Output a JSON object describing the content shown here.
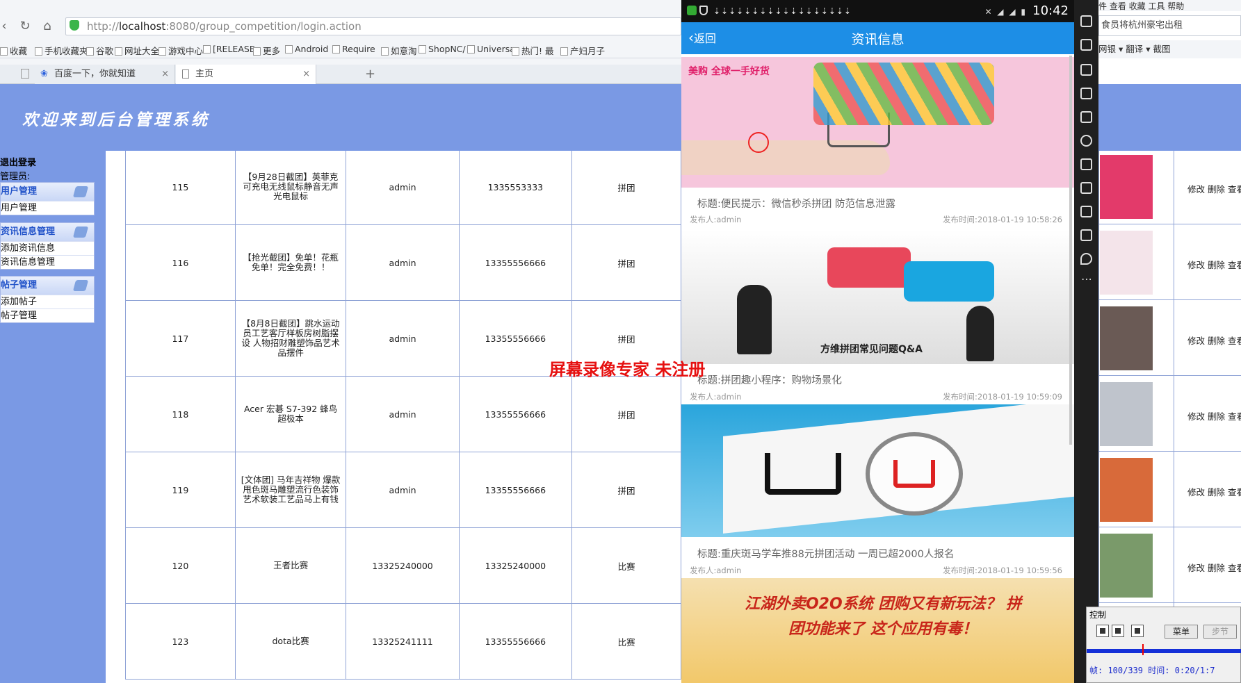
{
  "browser": {
    "url_host": "localhost",
    "url_prefix": "http://",
    "url_rest": ":8080/group_competition/login.action",
    "bookmarks": [
      "收藏",
      "手机收藏夹",
      "谷歌",
      "网址大全",
      "游戏中心",
      "[RELEASE",
      "更多",
      "Android",
      "Require",
      "如意淘",
      "ShopNC/",
      "Universa",
      "热门! 最",
      "产妇月子"
    ],
    "tabs": [
      {
        "label": "百度一下，你就知道",
        "active": false
      },
      {
        "label": "主页",
        "active": true
      }
    ]
  },
  "page": {
    "banner_title": "欢迎来到后台管理系统",
    "logout": "退出登录",
    "admin_label": "管理员:",
    "menus": [
      {
        "head": "用户管理",
        "items": [
          "用户管理"
        ]
      },
      {
        "head": "资讯信息管理",
        "items": [
          "添加资讯信息",
          "资讯信息管理"
        ]
      },
      {
        "head": "帖子管理",
        "items": [
          "添加帖子",
          "帖子管理"
        ]
      }
    ],
    "rows": [
      {
        "id": "115",
        "title": "【9月28日截团】英菲克可充电无线鼠标静音无声光电鼠标",
        "publisher": "admin",
        "phone": "1335553333",
        "type": "拼团"
      },
      {
        "id": "116",
        "title": "【抢光截团】免单！花瓶免单！完全免费！！",
        "publisher": "admin",
        "phone": "13355556666",
        "type": "拼团"
      },
      {
        "id": "117",
        "title": "【8月8日截团】跳水运动员工艺客厅样板房树脂摆设 人物招财雕塑饰品艺术品摆件",
        "publisher": "admin",
        "phone": "13355556666",
        "type": "拼团"
      },
      {
        "id": "118",
        "title": "Acer 宏碁 S7-392 蜂鸟超极本",
        "publisher": "admin",
        "phone": "13355556666",
        "type": "拼团"
      },
      {
        "id": "119",
        "title": "[文体团] 马年吉祥物 爆款甩色斑马雕塑流行色装饰艺术软装工艺品马上有钱",
        "publisher": "admin",
        "phone": "13355556666",
        "type": "拼团"
      },
      {
        "id": "120",
        "title": "王者比赛",
        "publisher": "13325240000",
        "phone": "13325240000",
        "type": "比赛"
      },
      {
        "id": "123",
        "title": "dota比赛",
        "publisher": "13325241111",
        "phone": "13355556666",
        "type": "比赛"
      }
    ],
    "actions": "修改 删除 查看"
  },
  "watermark": "屏幕录像专家  未注册",
  "phone": {
    "time": "10:42",
    "back_label": "返回",
    "title": "资讯信息",
    "news": [
      {
        "title": "标题:便民提示：微信秒杀拼团 防范信息泄露",
        "publisher": "发布人:admin",
        "time": "发布时间:2018-01-19 10:58:26",
        "img_caption": "美购 全球一手好货"
      },
      {
        "title": "标题:拼团趣小程序：购物场景化",
        "publisher": "发布人:admin",
        "time": "发布时间:2018-01-19 10:59:09",
        "img_caption": "方维拼团常见问题Q&A"
      },
      {
        "title": "标题:重庆斑马学车推88元拼团活动 一周已超2000人报名",
        "publisher": "发布人:admin",
        "time": "发布时间:2018-01-19 10:59:56",
        "img_caption": ""
      },
      {
        "title": "",
        "publisher": "",
        "time": "",
        "img_caption": "江湖外卖O2O系统 团购又有新玩法？ 拼团功能来了 这个应用有毒！"
      }
    ]
  },
  "right": {
    "menu": "件  查看  收藏  工具  帮助",
    "addr": "食员将杭州豪宅出租",
    "bookmarks": "网银 ▾ 翻译 ▾ 截图"
  },
  "recorder": {
    "title": "控制",
    "menu_btn": "菜单",
    "step_btn": "步节",
    "status": "帧: 100/339 时间: 0:20/1:7"
  },
  "colors": {
    "banner": "#7a99e4",
    "appbar": "#1d8ee6",
    "watermark": "#e61010"
  }
}
